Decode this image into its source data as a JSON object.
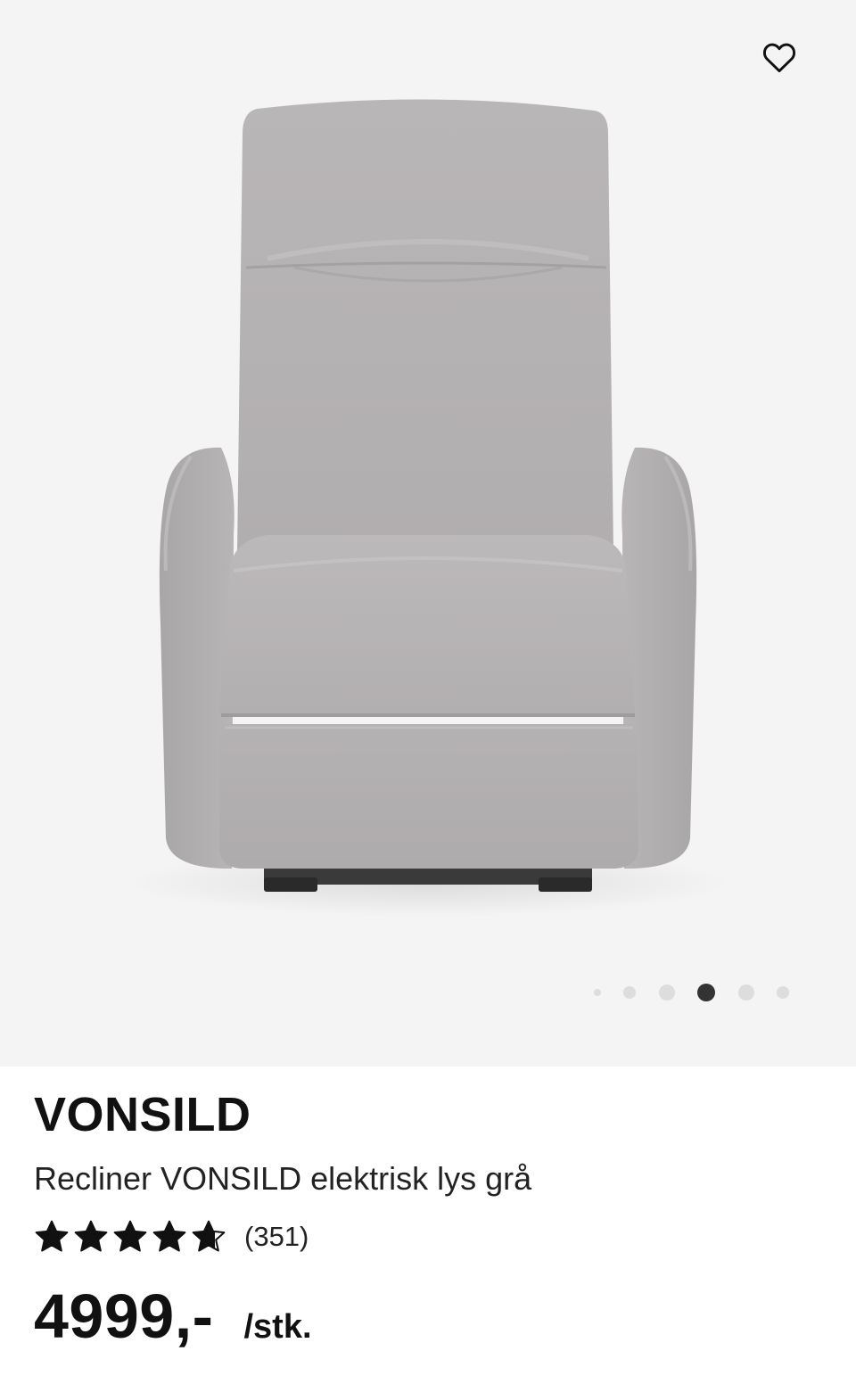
{
  "product": {
    "brand": "VONSILD",
    "description": "Recliner VONSILD elektrisk lys grå",
    "rating": {
      "stars": 4.7,
      "max_stars": 5,
      "review_count": "(351)"
    },
    "price": "4999,-",
    "unit": "/stk."
  },
  "gallery": {
    "image_count": 6,
    "active_index": 3
  },
  "icons": {
    "favorite": "heart-outline-icon",
    "star": "star-icon"
  },
  "colors": {
    "gallery_background": "#f4f4f4",
    "active_dot": "#333333",
    "inactive_dot": "#dddddd",
    "text": "#111111"
  }
}
